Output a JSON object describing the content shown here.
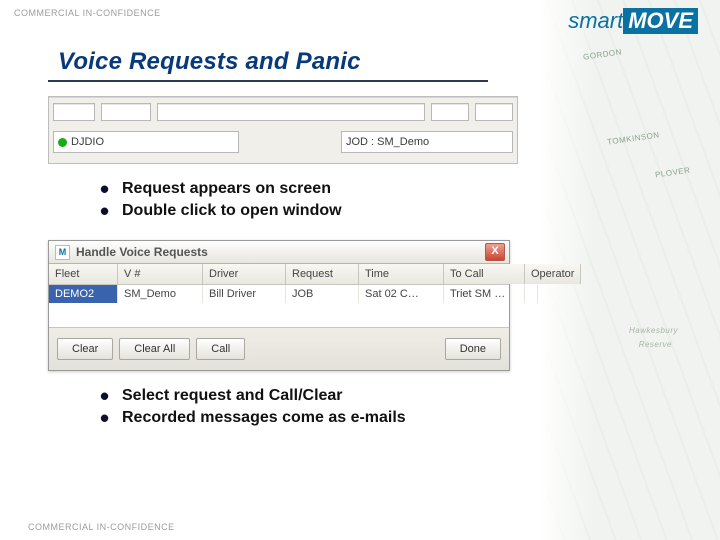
{
  "classification": "COMMERCIAL IN-CONFIDENCE",
  "brand": {
    "pre": "smart",
    "post": "MOVE"
  },
  "title": "Voice Requests and Panic",
  "shot1": {
    "status_left": "DJDIO",
    "status_right": "JOD : SM_Demo"
  },
  "bullets_a": [
    "Request appears on screen",
    "Double click to open window"
  ],
  "bullets_b": [
    "Select request and Call/Clear",
    "Recorded messages come as e-mails"
  ],
  "win": {
    "title": "Handle Voice Requests",
    "close": "X",
    "cols": [
      "Fleet",
      "V #",
      "Driver",
      "Request",
      "Time",
      "To Call",
      "Operator"
    ],
    "row": [
      "DEMO2",
      "SM_Demo",
      "Bill Driver",
      "JOB",
      "Sat 02 C…",
      "Triet SM …",
      ""
    ],
    "btn_clear": "Clear",
    "btn_clear_all": "Clear All",
    "btn_call": "Call",
    "btn_done": "Done"
  },
  "map_labels": [
    "GORDON",
    "TOMKINSON",
    "PLOVER",
    "Hawkesbury",
    "Reserve"
  ]
}
